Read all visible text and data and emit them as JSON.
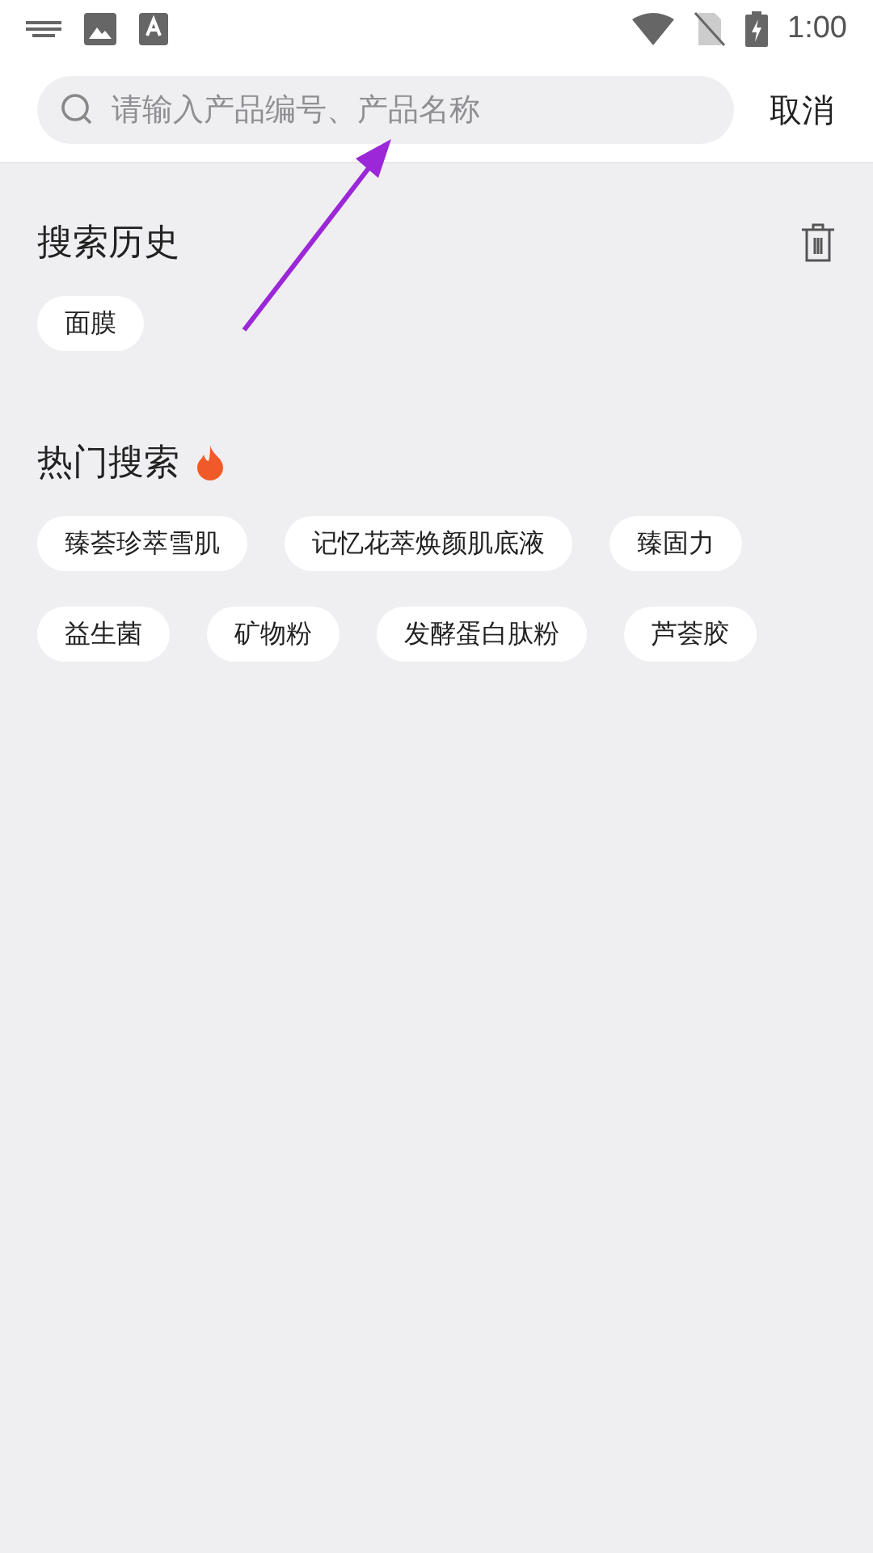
{
  "status_bar": {
    "time": "1:00"
  },
  "search": {
    "placeholder": "请输入产品编号、产品名称",
    "cancel": "取消"
  },
  "history": {
    "title": "搜索历史",
    "items": [
      "面膜"
    ]
  },
  "hot": {
    "title": "热门搜索",
    "items": [
      "臻荟珍萃雪肌",
      "记忆花萃焕颜肌底液",
      "臻固力",
      "益生菌",
      "矿物粉",
      "发酵蛋白肽粉",
      "芦荟胶"
    ]
  }
}
